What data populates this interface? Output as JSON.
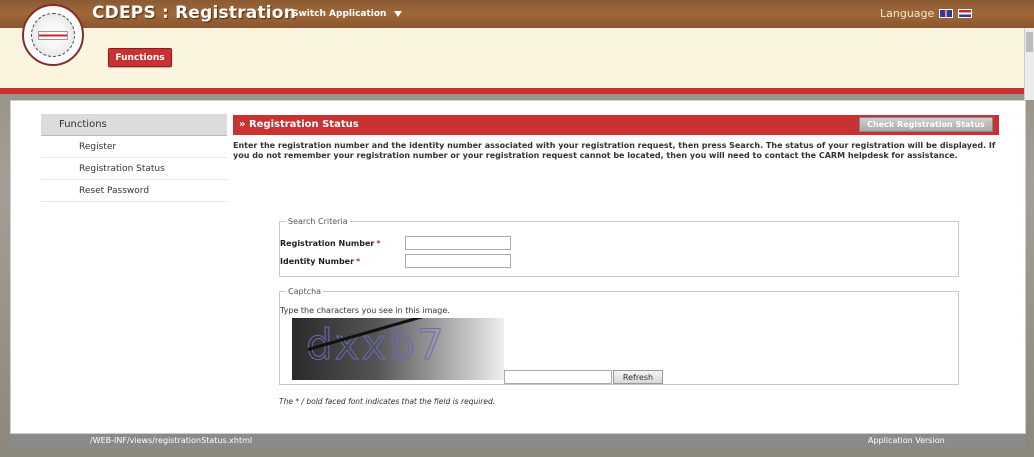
{
  "header": {
    "title": "CDEPS : Registration",
    "switch_application": "Switch Application",
    "language_label": "Language"
  },
  "band": {
    "functions_button": "Functions"
  },
  "sidebar": {
    "header": "Functions",
    "items": [
      {
        "label": "Register"
      },
      {
        "label": "Registration Status"
      },
      {
        "label": "Reset Password"
      }
    ]
  },
  "main": {
    "section_title": "» Registration Status",
    "check_button": "Check Registration Status",
    "intro": "Enter the registration number and the identity number associated with your registration request, then press Search. The status of your registration will be displayed. If you do not remember your registration number or your registration request cannot be located, then you will need to contact the CARM helpdesk for assistance.",
    "search_criteria": {
      "legend": "Search Criteria",
      "registration_number_label": "Registration Number",
      "identity_number_label": "Identity Number",
      "required_marker": "*",
      "registration_number_value": "",
      "identity_number_value": ""
    },
    "captcha": {
      "legend": "Captcha",
      "instruction": "Type the characters you see in this image.",
      "image_text": "dxxb7",
      "input_value": "",
      "refresh_button": "Refresh"
    },
    "note": "The * / bold faced font indicates that the field is required."
  },
  "footer": {
    "path": "/WEB-INF/views/registrationStatus.xhtml",
    "version": "Application Version"
  },
  "colors": {
    "brand_red": "#c83232",
    "topbar_brown": "#a06838",
    "band_cream": "#fbf5e0"
  }
}
